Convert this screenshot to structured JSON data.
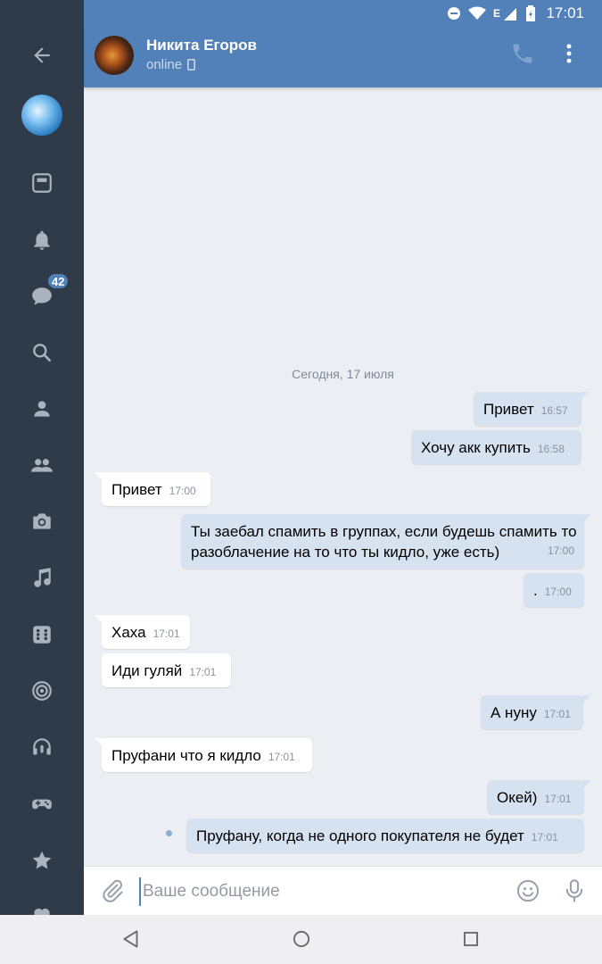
{
  "status_bar": {
    "time": "17:01",
    "network": "E"
  },
  "header": {
    "name": "Никита Егоров",
    "status": "online"
  },
  "sidebar": {
    "messages_badge": "42"
  },
  "chat": {
    "date_separator": "Сегодня, 17 июля",
    "messages": [
      {
        "dir": "out",
        "text": "Привет",
        "time": "16:57"
      },
      {
        "dir": "out",
        "text": "Хочу акк купить",
        "time": "16:58"
      },
      {
        "dir": "in",
        "text": "Привет",
        "time": "17:00"
      },
      {
        "dir": "out",
        "text": "Ты заебал спамить в группах, если будешь спамить то разоблачение на то что ты кидло, уже есть)",
        "time": "17:00"
      },
      {
        "dir": "out",
        "text": ".",
        "time": "17:00"
      },
      {
        "dir": "in",
        "text": "Хаха",
        "time": "17:01"
      },
      {
        "dir": "in",
        "text": "Иди гуляй",
        "time": "17:01"
      },
      {
        "dir": "out",
        "text": "А нуну",
        "time": "17:01"
      },
      {
        "dir": "in",
        "text": "Пруфани что я кидло",
        "time": "17:01"
      },
      {
        "dir": "out",
        "text": "Окей)",
        "time": "17:01"
      },
      {
        "dir": "out",
        "text": "Пруфану, когда не одного покупателя не будет",
        "time": "17:01",
        "unread": true
      }
    ]
  },
  "composer": {
    "placeholder": "Ваше сообщение"
  },
  "colors": {
    "accent": "#5181b8",
    "sidebar": "#2f3b48",
    "outgoing_bubble": "#d6e2f0",
    "background": "#ebeef2"
  }
}
